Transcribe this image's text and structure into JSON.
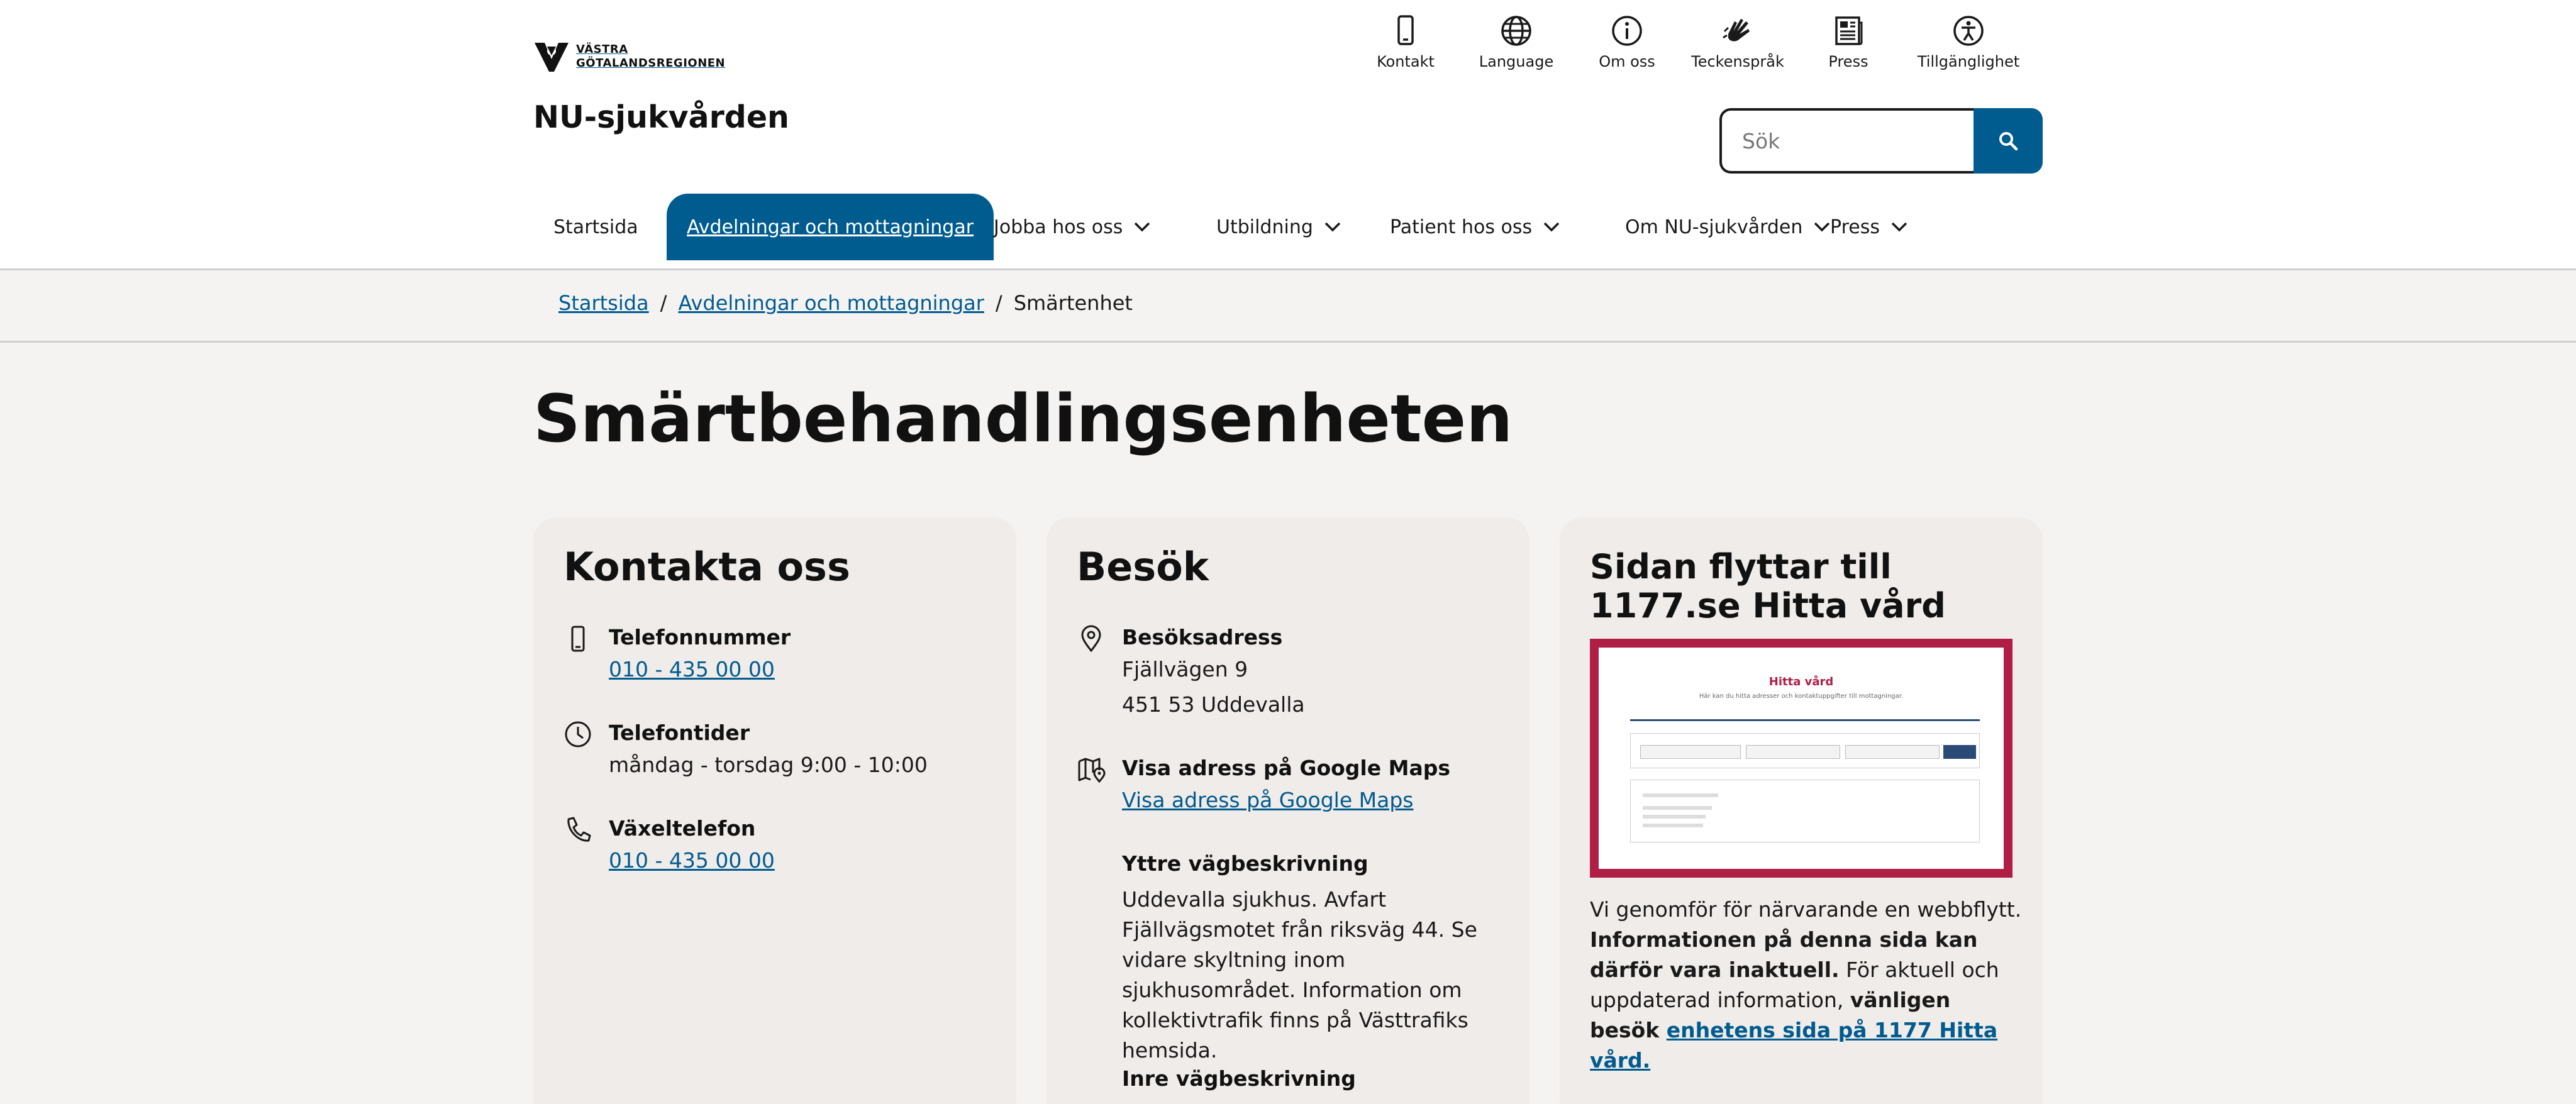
{
  "header": {
    "logo_line1": "VÄSTRA",
    "logo_line2": "GÖTALANDSREGIONEN",
    "site_title": "NU-sjukvården",
    "top_links": [
      {
        "label": "Kontakt",
        "icon": "phone-icon"
      },
      {
        "label": "Language",
        "icon": "globe-icon"
      },
      {
        "label": "Om oss",
        "icon": "info-icon"
      },
      {
        "label": "Teckenspråk",
        "icon": "sign-language-icon"
      },
      {
        "label": "Press",
        "icon": "newspaper-icon"
      },
      {
        "label": "Tillgänglighet",
        "icon": "accessibility-icon"
      }
    ],
    "search_placeholder": "Sök"
  },
  "nav": {
    "items": [
      {
        "label": "Startsida"
      },
      {
        "label": "Avdelningar och mottagningar",
        "active": true
      },
      {
        "label": "Jobba hos oss"
      },
      {
        "label": "Utbildning"
      },
      {
        "label": "Patient hos oss"
      },
      {
        "label": "Om NU-sjukvården"
      },
      {
        "label": "Press"
      }
    ]
  },
  "breadcrumb": {
    "items": [
      "Startsida",
      "Avdelningar och mottagningar"
    ],
    "current": "Smärtenhet",
    "sep": "/"
  },
  "page_title": "Smärtbehandlingsenheten",
  "contact": {
    "title": "Kontakta oss",
    "phone_label": "Telefonnummer",
    "phone_value": "010 - 435 00 00",
    "hours_label": "Telefontider",
    "hours_value": "måndag - torsdag 9:00 - 10:00",
    "switch_label": "Växeltelefon",
    "switch_value": "010 - 435 00 00"
  },
  "visit": {
    "title": "Besök",
    "address_label": "Besöksadress",
    "address_line1": "Fjällvägen 9",
    "address_line2": "451 53 Uddevalla",
    "maps_label": "Visa adress på Google Maps",
    "maps_link": "Visa adress på Google Maps",
    "outer_label": "Yttre vägbeskrivning",
    "outer_text": "Uddevalla sjukhus. Avfart Fjällvägsmotet från riksväg 44. Se vidare skyltning inom sjukhusområdet. Information om kollektivtrafik finns på Västtrafiks hemsida.",
    "inner_label": "Inre vägbeskrivning"
  },
  "move": {
    "title": "Sidan flyttar till 1177.se Hitta vård",
    "preview_title": "Hitta vård",
    "preview_sub": "Här kan du hitta adresser och kontaktuppgifter till mottagningar.",
    "text_1": "Vi genomför för närvarande en webbflytt. ",
    "text_bold": "Informationen på denna sida kan därför vara inaktuell.",
    "text_2": " För aktuell och uppdaterad information, ",
    "text_bold2": "vänligen besök ",
    "link": "enhetens sida på 1177 Hitta vård."
  },
  "colors": {
    "primary": "#005b8f",
    "preview_border": "#b01d45",
    "card_bg": "#f0ece9",
    "page_bg": "#f5f3f2"
  }
}
